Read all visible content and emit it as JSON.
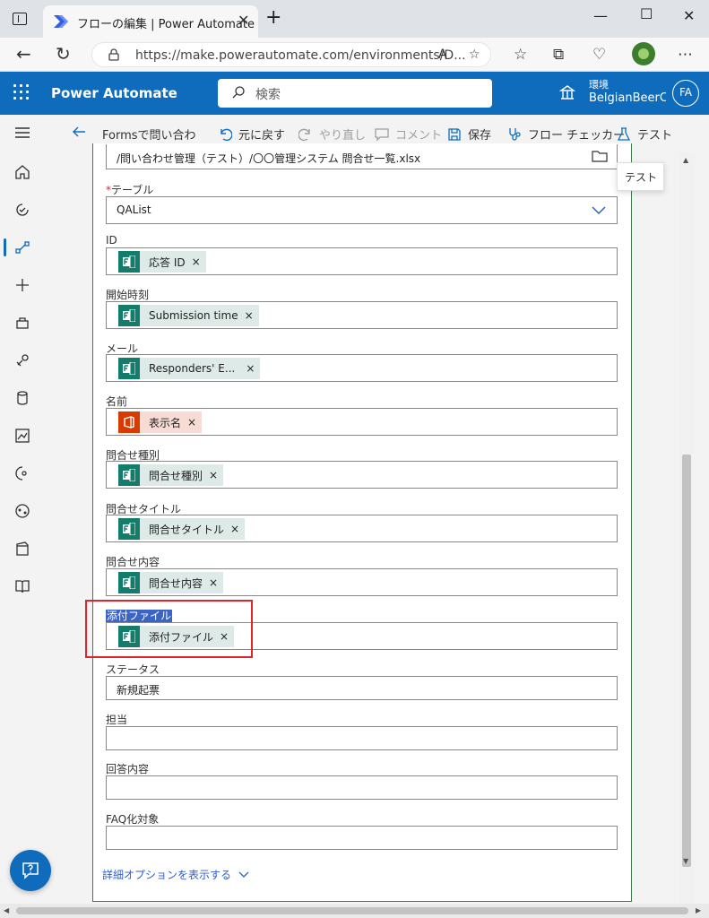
{
  "browser": {
    "tab_title": "フローの編集 | Power Automate",
    "url": "https://make.powerautomate.com/environments/D..."
  },
  "header": {
    "app_name": "Power Automate",
    "search_placeholder": "検索",
    "env_label": "環境",
    "env_name": "BelgianBeerCo",
    "avatar_initials": "FA"
  },
  "commandbar": {
    "flow_name": "Formsで問い合わ",
    "undo": "元に戻す",
    "redo": "やり直し",
    "comment": "コメント",
    "save": "保存",
    "checker": "フロー チェッカー",
    "test": "テスト"
  },
  "tooltip": "テスト",
  "file_path": "/問い合わせ管理（テスト）/〇〇管理システム 問合せ一覧.xlsx",
  "table": {
    "label": "テーブル",
    "value": "QAList"
  },
  "fields": [
    {
      "label": "ID",
      "token": "応答 ID"
    },
    {
      "label": "開始時刻",
      "token": "Submission time"
    },
    {
      "label": "メール",
      "token": "Responders' E..."
    },
    {
      "label": "名前",
      "token": "表示名"
    },
    {
      "label": "問合せ種別",
      "token": "問合せ種別"
    },
    {
      "label": "問合せタイトル",
      "token": "問合せタイトル"
    },
    {
      "label": "問合せ内容",
      "token": "問合せ内容"
    },
    {
      "label": "添付ファイル",
      "token": "添付ファイル"
    },
    {
      "label": "ステータス",
      "value": "新規起票"
    },
    {
      "label": "担当",
      "value": ""
    },
    {
      "label": "回答内容",
      "value": ""
    },
    {
      "label": "FAQ化対象",
      "value": ""
    }
  ],
  "advanced_link": "詳細オプションを表示する",
  "colors": {
    "brand": "#0f6cbd",
    "forms_token": "#137c6b",
    "office_token": "#d83b01",
    "card_border": "#3b7e4c",
    "annotation": "#e0242b"
  }
}
